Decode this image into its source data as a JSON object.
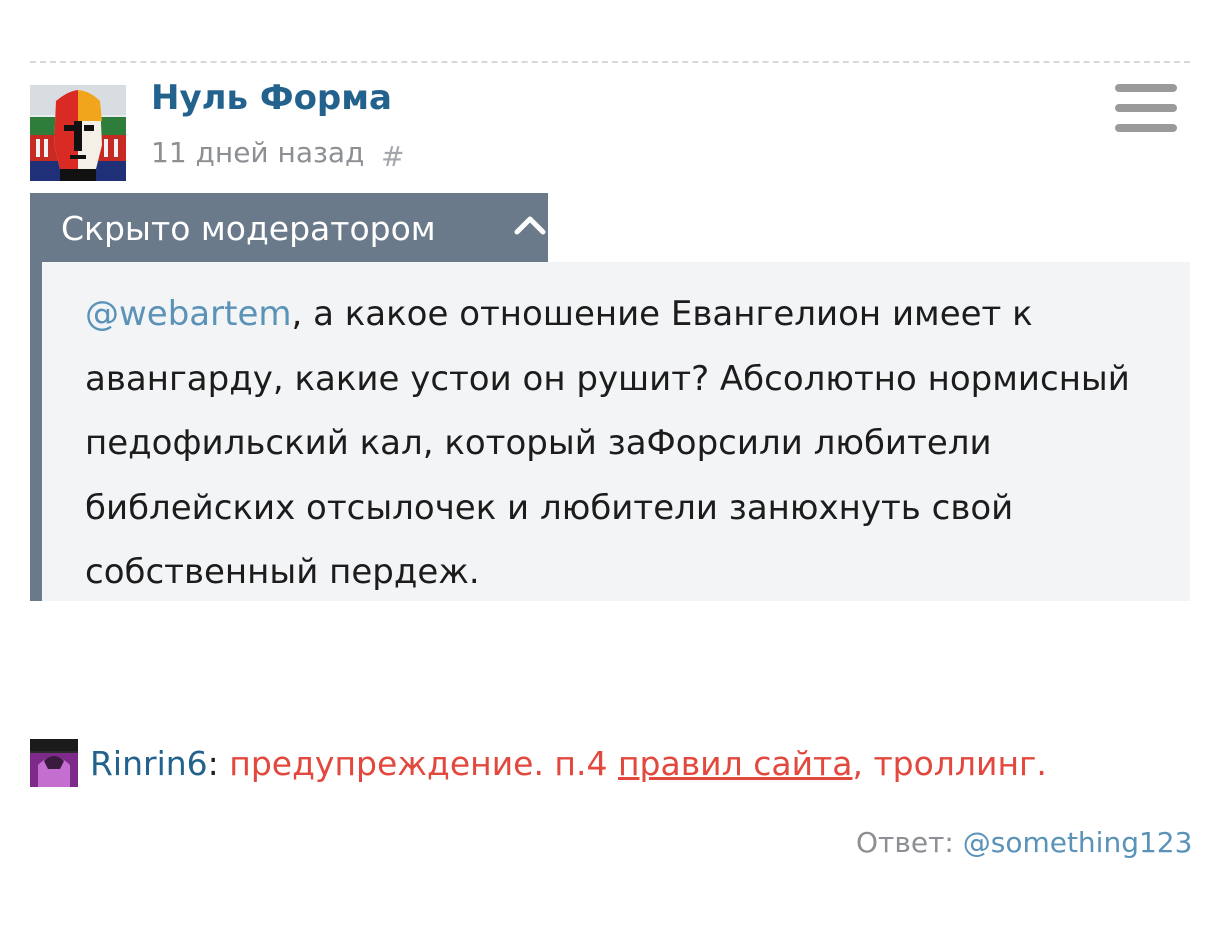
{
  "comment": {
    "author": "Нуль Форма",
    "timestamp": "11 дней назад",
    "permalink_symbol": "#",
    "hidden_banner": {
      "label": "Скрыто модератором",
      "icon": "chevron-up-icon"
    },
    "menu_icon": "hamburger-menu-icon",
    "mention": "@webartem",
    "text": ", а какое отношение Евангелион имеет к авангарду, какие устои он рушит? Абсолютно нормисный педофильский кал, который заФорсили любители библейских отсылочек и любители занюхнуть свой собственный пердеж."
  },
  "moderation": {
    "moderator": "Rinrin6",
    "separator": ": ",
    "warning_prefix": "предупреждение. п.4 ",
    "rules_link": "правил сайта",
    "warning_suffix": ", троллинг."
  },
  "reply": {
    "label": "Ответ: ",
    "target": "@something123"
  },
  "colors": {
    "author": "#24628e",
    "mention": "#5a92b8",
    "banner": "#6a7a8a",
    "comment_bg": "#f3f4f6",
    "warning": "#e2483d",
    "muted": "#8c8f93"
  }
}
